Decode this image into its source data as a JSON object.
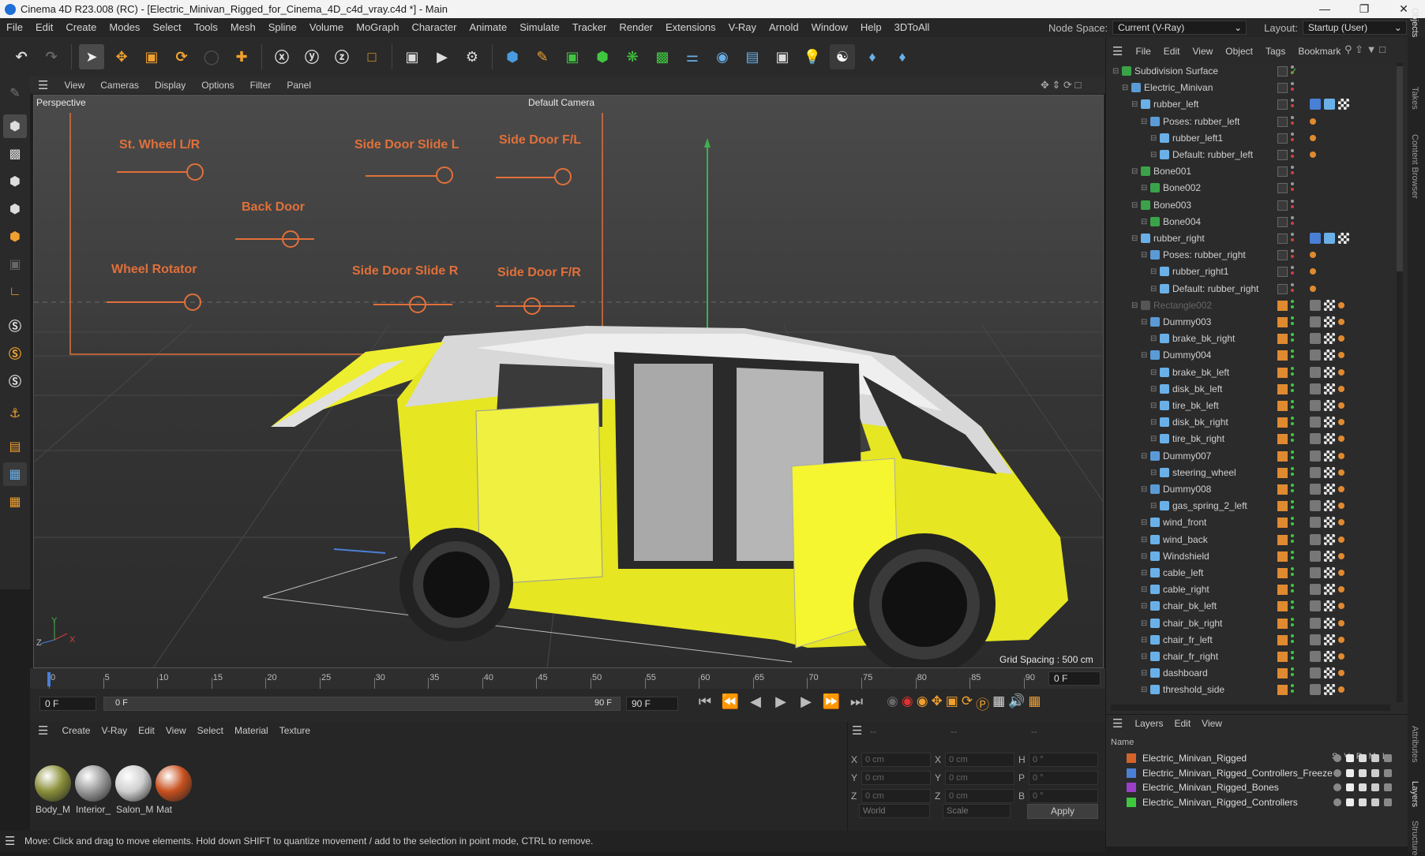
{
  "window": {
    "title": "Cinema 4D R23.008 (RC) - [Electric_Minivan_Rigged_for_Cinema_4D_c4d_vray.c4d *] - Main"
  },
  "menubar": {
    "items": [
      "File",
      "Edit",
      "Create",
      "Modes",
      "Select",
      "Tools",
      "Mesh",
      "Spline",
      "Volume",
      "MoGraph",
      "Character",
      "Animate",
      "Simulate",
      "Tracker",
      "Render",
      "Extensions",
      "V-Ray",
      "Arnold",
      "Window",
      "Help",
      "3DToAll"
    ],
    "node_space_label": "Node Space:",
    "node_space_value": "Current (V-Ray)",
    "layout_label": "Layout:",
    "layout_value": "Startup (User)"
  },
  "viewport": {
    "menu": [
      "View",
      "Cameras",
      "Display",
      "Options",
      "Filter",
      "Panel"
    ],
    "view_name": "Perspective",
    "camera_name": "Default Camera",
    "grid_spacing": "Grid Spacing : 500 cm",
    "controls": {
      "st_wheel": "St. Wheel L/R",
      "slide_door_l": "Side Door Slide L",
      "side_door_fl": "Side Door F/L",
      "back_door": "Back  Door",
      "wheel_rotator": "Wheel Rotator",
      "slide_door_r": "Side Door Slide R",
      "side_door_fr": "Side Door F/R"
    }
  },
  "timeline": {
    "ticks": [
      "0",
      "5",
      "10",
      "15",
      "20",
      "25",
      "30",
      "35",
      "40",
      "45",
      "50",
      "55",
      "60",
      "65",
      "70",
      "75",
      "80",
      "85",
      "90"
    ],
    "current_frame": "0 F",
    "start_frame": "0 F",
    "range_start": "0 F",
    "range_end": "90 F",
    "end_frame": "90 F"
  },
  "material_manager": {
    "menu": [
      "Create",
      "V-Ray",
      "Edit",
      "View",
      "Select",
      "Material",
      "Texture"
    ],
    "materials": [
      {
        "label": "Body_M",
        "color": "#8a8f3a"
      },
      {
        "label": "Interior_",
        "color": "#9a9a9a"
      },
      {
        "label": "Salon_M",
        "color": "#cfcfcf"
      },
      {
        "label": "Mat",
        "color": "#c8501e"
      }
    ]
  },
  "coords": {
    "separators": "--",
    "x": "X",
    "y": "Y",
    "z": "Z",
    "h": "H",
    "p": "P",
    "b": "B",
    "pos_value": "0 cm",
    "rot_value": "0 °",
    "mode_world": "World",
    "mode_scale": "Scale",
    "apply": "Apply"
  },
  "objects": {
    "menu": [
      "File",
      "Edit",
      "View",
      "Object",
      "Tags",
      "Bookmark"
    ],
    "rows": [
      {
        "name": "Subdivision Surface",
        "indent": 0,
        "icon": "#3aa34a"
      },
      {
        "name": "Electric_Minivan",
        "indent": 1,
        "icon": "#5a9bd6"
      },
      {
        "name": "rubber_left",
        "indent": 2,
        "icon": "#6ab0e8"
      },
      {
        "name": "Poses: rubber_left",
        "indent": 3,
        "icon": "#5a9bd6"
      },
      {
        "name": "rubber_left1",
        "indent": 4,
        "icon": "#6ab0e8"
      },
      {
        "name": "Default: rubber_left",
        "indent": 4,
        "icon": "#6ab0e8"
      },
      {
        "name": "Bone001",
        "indent": 2,
        "icon": "#3aa34a"
      },
      {
        "name": "Bone002",
        "indent": 3,
        "icon": "#3aa34a"
      },
      {
        "name": "Bone003",
        "indent": 2,
        "icon": "#3aa34a"
      },
      {
        "name": "Bone004",
        "indent": 3,
        "icon": "#3aa34a"
      },
      {
        "name": "rubber_right",
        "indent": 2,
        "icon": "#6ab0e8"
      },
      {
        "name": "Poses: rubber_right",
        "indent": 3,
        "icon": "#5a9bd6"
      },
      {
        "name": "rubber_right1",
        "indent": 4,
        "icon": "#6ab0e8"
      },
      {
        "name": "Default: rubber_right",
        "indent": 4,
        "icon": "#6ab0e8"
      },
      {
        "name": "Rectangle002",
        "indent": 2,
        "icon": "#555555"
      },
      {
        "name": "Dummy003",
        "indent": 3,
        "icon": "#5a9bd6"
      },
      {
        "name": "brake_bk_right",
        "indent": 4,
        "icon": "#6ab0e8"
      },
      {
        "name": "Dummy004",
        "indent": 3,
        "icon": "#5a9bd6"
      },
      {
        "name": "brake_bk_left",
        "indent": 4,
        "icon": "#6ab0e8"
      },
      {
        "name": "disk_bk_left",
        "indent": 4,
        "icon": "#6ab0e8"
      },
      {
        "name": "tire_bk_left",
        "indent": 4,
        "icon": "#6ab0e8"
      },
      {
        "name": "disk_bk_right",
        "indent": 4,
        "icon": "#6ab0e8"
      },
      {
        "name": "tire_bk_right",
        "indent": 4,
        "icon": "#6ab0e8"
      },
      {
        "name": "Dummy007",
        "indent": 3,
        "icon": "#5a9bd6"
      },
      {
        "name": "steering_wheel",
        "indent": 4,
        "icon": "#6ab0e8"
      },
      {
        "name": "Dummy008",
        "indent": 3,
        "icon": "#5a9bd6"
      },
      {
        "name": "gas_spring_2_left",
        "indent": 4,
        "icon": "#6ab0e8"
      },
      {
        "name": "wind_front",
        "indent": 3,
        "icon": "#6ab0e8"
      },
      {
        "name": "wind_back",
        "indent": 3,
        "icon": "#6ab0e8"
      },
      {
        "name": "Windshield",
        "indent": 3,
        "icon": "#6ab0e8"
      },
      {
        "name": "cable_left",
        "indent": 3,
        "icon": "#6ab0e8"
      },
      {
        "name": "cable_right",
        "indent": 3,
        "icon": "#6ab0e8"
      },
      {
        "name": "chair_bk_left",
        "indent": 3,
        "icon": "#6ab0e8"
      },
      {
        "name": "chair_bk_right",
        "indent": 3,
        "icon": "#6ab0e8"
      },
      {
        "name": "chair_fr_left",
        "indent": 3,
        "icon": "#6ab0e8"
      },
      {
        "name": "chair_fr_right",
        "indent": 3,
        "icon": "#6ab0e8"
      },
      {
        "name": "dashboard",
        "indent": 3,
        "icon": "#6ab0e8"
      },
      {
        "name": "threshold_side",
        "indent": 3,
        "icon": "#6ab0e8"
      }
    ]
  },
  "layers": {
    "menu": [
      "Layers",
      "Edit",
      "View"
    ],
    "col_name": "Name",
    "cols": [
      "S",
      "V",
      "R",
      "M",
      "L"
    ],
    "rows": [
      {
        "name": "Electric_Minivan_Rigged",
        "color": "#d4632a"
      },
      {
        "name": "Electric_Minivan_Rigged_Controllers_Freeze",
        "color": "#4a7fd6"
      },
      {
        "name": "Electric_Minivan_Rigged_Bones",
        "color": "#9a3fc8"
      },
      {
        "name": "Electric_Minivan_Rigged_Controllers",
        "color": "#3fc83f"
      }
    ]
  },
  "side_tabs": [
    "Objects",
    "Takes",
    "Content Browser",
    "Attributes",
    "Layers",
    "Structure"
  ],
  "status": "Move: Click and drag to move elements. Hold down SHIFT to quantize movement / add to the selection in point mode, CTRL to remove."
}
